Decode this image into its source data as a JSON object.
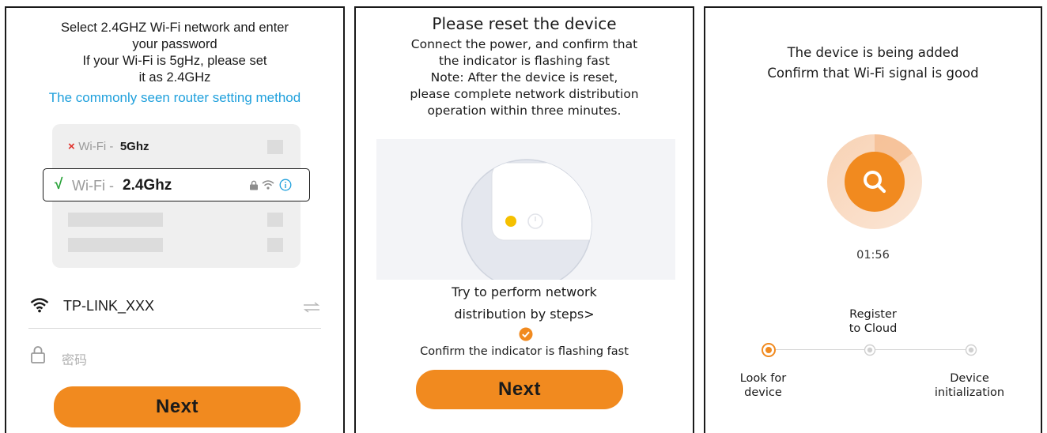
{
  "panel1": {
    "instructions": [
      "Select 2.4GHZ Wi-Fi network and enter",
      "your password",
      "If your Wi-Fi is 5gHz, please set",
      "it as 2.4GHz"
    ],
    "router_link": "The commonly seen router setting method",
    "wifi_list": {
      "bad_row": {
        "mark": "×",
        "prefix": "Wi-Fi -",
        "band": "5Ghz"
      },
      "good_row": {
        "mark": "√",
        "prefix": "Wi-Fi -",
        "band": "2.4Ghz"
      }
    },
    "network_name": "TP-LINK_XXX",
    "password_placeholder": "密码",
    "next_label": "Next"
  },
  "panel2": {
    "title": "Please reset the device",
    "instructions": [
      "Connect the power, and confirm that",
      "the indicator is flashing fast",
      "Note: After the device is reset,",
      "please complete network distribution",
      "operation within three minutes."
    ],
    "steps_link": [
      "Try to perform network",
      "distribution by steps>"
    ],
    "confirm_label": "Confirm the indicator is flashing fast",
    "next_label": "Next"
  },
  "panel3": {
    "lines": [
      "The device is being added",
      "Confirm that Wi-Fi signal is good"
    ],
    "timer": "01:56",
    "steps": {
      "step1": [
        "Look for",
        "device"
      ],
      "step2": [
        "Register",
        "to Cloud"
      ],
      "step3": [
        "Device",
        "initialization"
      ]
    }
  },
  "colors": {
    "accent": "#f18a1f",
    "link": "#1fa0dc",
    "check_green": "#2aa33a",
    "cross_red": "#e0302a",
    "indicator_yellow": "#f5c000"
  }
}
